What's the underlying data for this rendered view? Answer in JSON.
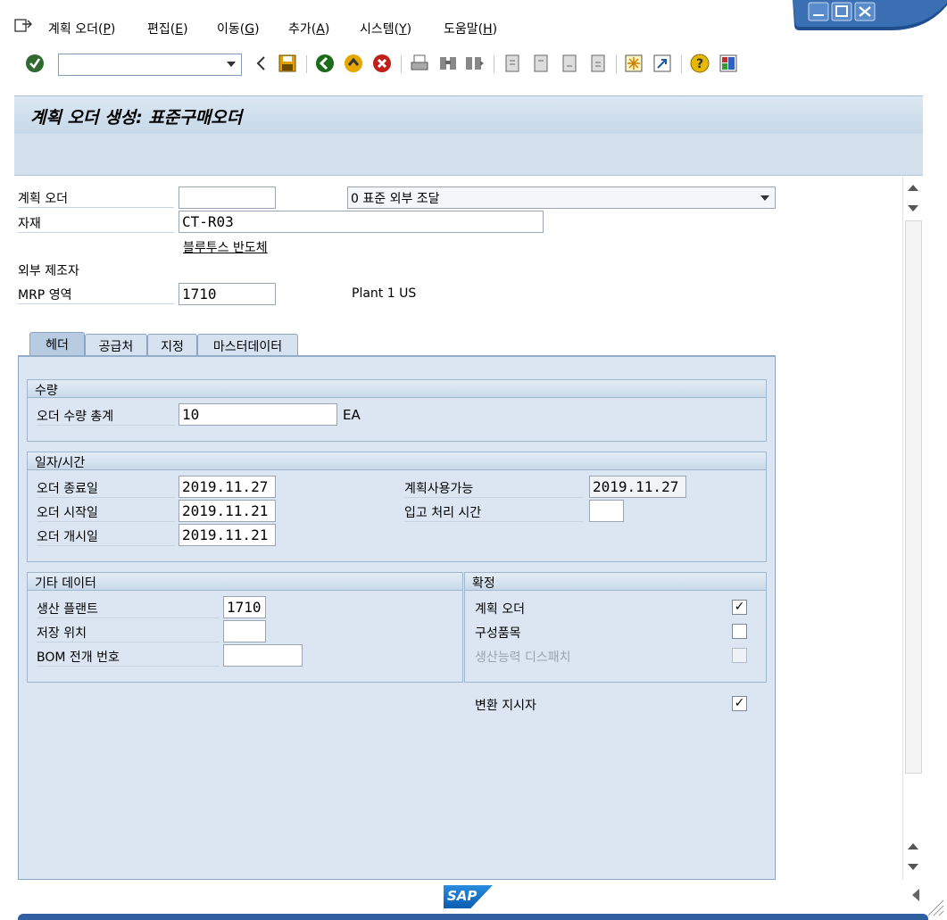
{
  "menu": [
    {
      "label": "계획 오더(",
      "key": "P",
      "tail": ")"
    },
    {
      "label": "편집(",
      "key": "E",
      "tail": ")"
    },
    {
      "label": "이동(",
      "key": "G",
      "tail": ")"
    },
    {
      "label": "추가(",
      "key": "A",
      "tail": ")"
    },
    {
      "label": "시스템(",
      "key": "Y",
      "tail": ")"
    },
    {
      "label": "도움말(",
      "key": "H",
      "tail": ")"
    }
  ],
  "toolbar": {
    "command_value": "",
    "icons": [
      "enter-icon",
      "back-arrow-icon",
      "save-icon",
      "back-icon",
      "exit-icon",
      "cancel-icon",
      "print-icon",
      "find-icon",
      "find-next-icon",
      "first-page-icon",
      "previous-page-icon",
      "next-page-icon",
      "last-page-icon",
      "create-session-icon",
      "shortcut-icon",
      "help-icon",
      "customize-layout-icon"
    ]
  },
  "title": "계획 오더 생성: 표준구매오더",
  "header": {
    "planned_order_label": "계획 오더",
    "planned_order_value": "",
    "procurement_value": "0 표준 외부 조달",
    "material_label": "자재",
    "material_value": "CT-R03",
    "material_desc": "블루투스 반도체",
    "ext_manufacturer_label": "외부 제조자",
    "mrp_area_label": "MRP 영역",
    "mrp_area_value": "1710",
    "mrp_area_desc": "Plant 1 US"
  },
  "tabs": [
    "헤더",
    "공급처",
    "지정",
    "마스터데이터"
  ],
  "quantity": {
    "title": "수량",
    "total_label": "오더 수량 총계",
    "total_value": "10",
    "unit": "EA"
  },
  "dates": {
    "title": "일자/시간",
    "end_label": "오더 종료일",
    "end_value": "2019.11.27",
    "start_label": "오더 시작일",
    "start_value": "2019.11.21",
    "open_label": "오더 개시일",
    "open_value": "2019.11.21",
    "avail_label": "계획사용가능",
    "avail_value": "2019.11.27",
    "gr_time_label": "입고 처리 시간",
    "gr_time_value": ""
  },
  "other": {
    "title": "기타 데이터",
    "plant_label": "생산 플랜트",
    "plant_value": "1710",
    "sloc_label": "저장 위치",
    "sloc_value": "",
    "bom_label": "BOM 전개 번호",
    "bom_value": ""
  },
  "firming": {
    "title": "확정",
    "planned_label": "계획 오더",
    "planned_checked": true,
    "component_label": "구성품목",
    "component_checked": false,
    "capacity_label": "생산능력 디스패치",
    "capacity_checked": false
  },
  "conversion": {
    "label": "변환 지시자",
    "checked": true
  },
  "footer": {
    "logo": "SAP"
  }
}
